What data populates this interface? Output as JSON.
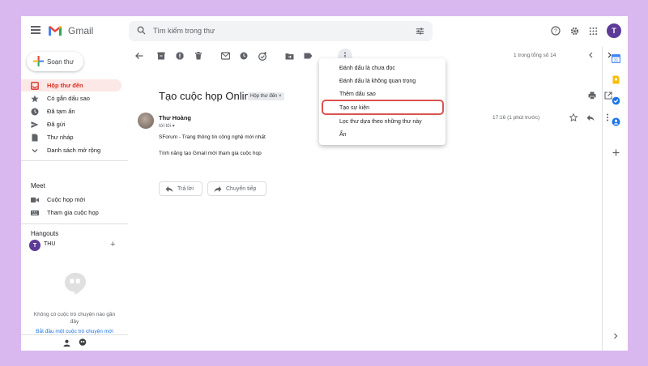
{
  "header": {
    "brand": "Gmail",
    "search_placeholder": "Tìm kiếm trong thư",
    "avatar_initial": "T",
    "icons": [
      "menu-icon",
      "gmail-logo-icon",
      "search-icon",
      "tune-icon",
      "help-icon",
      "settings-icon",
      "apps-icon"
    ]
  },
  "sidebar": {
    "compose_label": "Soạn thư",
    "items": [
      {
        "label": "Hộp thư đến",
        "icon": "inbox-icon",
        "active": true
      },
      {
        "label": "Có gắn dấu sao",
        "icon": "star-icon"
      },
      {
        "label": "Đã tạm ẩn",
        "icon": "clock-icon"
      },
      {
        "label": "Đã gửi",
        "icon": "send-icon"
      },
      {
        "label": "Thư nháp",
        "icon": "draft-icon"
      },
      {
        "label": "Danh sách mở rộng",
        "icon": "chevron-down-icon"
      }
    ],
    "meet": {
      "title": "Meet",
      "items": [
        {
          "label": "Cuộc họp mới",
          "icon": "video-icon"
        },
        {
          "label": "Tham gia cuộc họp",
          "icon": "keyboard-icon"
        }
      ]
    },
    "hangouts": {
      "title": "Hangouts",
      "user_initial": "T",
      "user_name": "THU",
      "empty_text": "Không có cuộc trò chuyện nào gần đây",
      "start_link": "Bắt đầu một cuộc trò chuyện mới"
    }
  },
  "toolbar": {
    "pager": "1 trong tổng số 14",
    "icons": [
      "back-arrow-icon",
      "archive-icon",
      "report-spam-icon",
      "delete-icon",
      "mark-unread-icon",
      "snooze-icon",
      "add-task-icon",
      "move-to-icon",
      "label-icon",
      "more-vert-icon"
    ]
  },
  "email": {
    "subject": "Tạo cuộc họp Online",
    "label_chip": "Hộp thư đến ×",
    "sender": "Thư Hoàng",
    "recipient": "tới tôi ▾",
    "time": "17:16 (1 phút trước)",
    "body_line1": "SForum - Trang thông tin công nghệ mới nhất",
    "body_line2": "Tính năng tạo Gmail mới tham gia cuộc họp",
    "reply_label": "Trả lời",
    "forward_label": "Chuyển tiếp"
  },
  "menu": {
    "items": [
      "Đánh dấu là chưa đọc",
      "Đánh dấu là không quan trọng",
      "Thêm dấu sao",
      "Tạo sự kiện",
      "Lọc thư dựa theo những thư này",
      "Ẩn"
    ],
    "highlighted_index": 3,
    "highlight_color": "#d9534f"
  },
  "right_rail": {
    "icons": [
      "calendar-icon",
      "keep-icon",
      "tasks-icon",
      "contacts-icon",
      "add-icon",
      "expand-icon"
    ]
  },
  "colors": {
    "background": "#d8b8ee",
    "accent_red": "#d93025",
    "active_bg": "#fce8e6",
    "link_blue": "#1a73e8",
    "avatar": "#5c3a97"
  }
}
